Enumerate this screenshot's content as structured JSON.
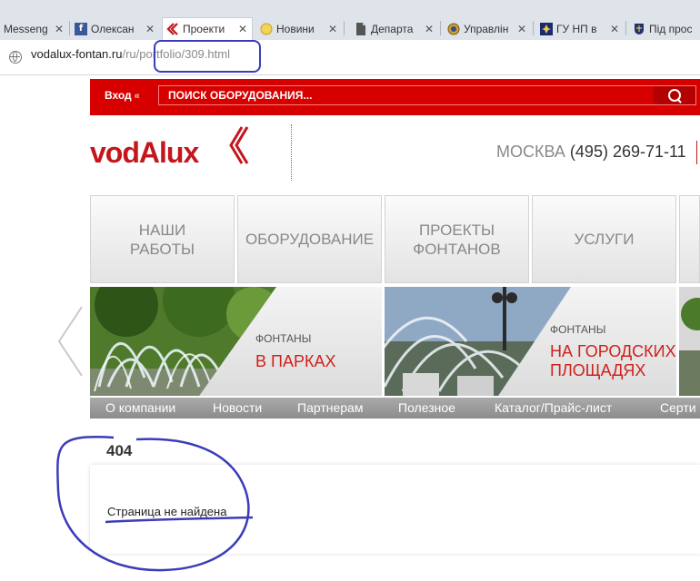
{
  "browser": {
    "tabs": [
      {
        "title": "Messeng",
        "favicon": "messenger-icon",
        "active": false
      },
      {
        "title": "Олексан",
        "favicon": "facebook-icon",
        "active": false
      },
      {
        "title": "Проекти",
        "favicon": "vodalux-icon",
        "active": true
      },
      {
        "title": "Новини",
        "favicon": "news-icon",
        "active": false
      },
      {
        "title": "Департа",
        "favicon": "document-icon",
        "active": false
      },
      {
        "title": "Управлін",
        "favicon": "emblem-icon",
        "active": false
      },
      {
        "title": "ГУ НП в",
        "favicon": "police-icon",
        "active": false
      },
      {
        "title": "Під прос",
        "favicon": "crest-icon",
        "active": false
      }
    ],
    "url": {
      "host": "vodalux-fontan.ru",
      "path": "/ru/portfolio/309.html"
    }
  },
  "header": {
    "login_label": "Вход",
    "search_placeholder": "ПОИСК ОБОРУДОВАНИЯ...",
    "logo_text": "vodAlux",
    "city": "МОСКВА",
    "phone": "(495) 269-71-11"
  },
  "menu": [
    {
      "label": "Наши работы"
    },
    {
      "label": "Оборудование"
    },
    {
      "label": "Проекты фонтанов"
    },
    {
      "label": "Услуги"
    }
  ],
  "banners": [
    {
      "subtitle": "ФОНТАНЫ",
      "title": "В ПАРКАХ"
    },
    {
      "subtitle": "ФОНТАНЫ",
      "title": "НА ГОРОДСКИХ ПЛОЩАДЯХ"
    }
  ],
  "subnav": [
    "О компании",
    "Новости",
    "Партнерам",
    "Полезное",
    "Каталог/Прайс-лист",
    "Серти"
  ],
  "error": {
    "code": "404",
    "message": "Страница не найдена"
  },
  "colors": {
    "brand_red": "#d60000",
    "annotation_blue": "#3a3cb8"
  }
}
